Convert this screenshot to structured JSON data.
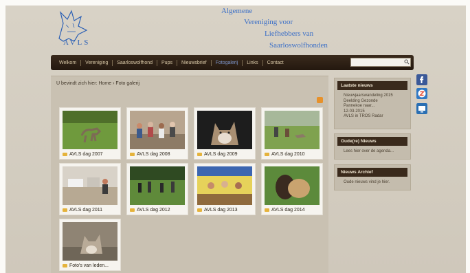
{
  "header": {
    "logo_text": "AVLS",
    "tagline": [
      "Algemene",
      "Vereniging voor",
      "Liefhebbers van",
      "Saarloswolfhonden"
    ]
  },
  "nav": {
    "items": [
      "Welkom",
      "Vereniging",
      "Saarloswolfhond",
      "Pups",
      "Nieuwsbrief",
      "Fotogalerij",
      "Links",
      "Contact"
    ],
    "active_index": 5,
    "search_placeholder": ""
  },
  "breadcrumb": {
    "prefix": "U bevindt zich hier:",
    "home": "Home",
    "separator": "›",
    "current": "Foto galerij"
  },
  "gallery": {
    "items": [
      {
        "label": "AVLS dag 2007",
        "thumb": "dog-on-grass"
      },
      {
        "label": "AVLS dag 2008",
        "thumb": "people-with-dogs"
      },
      {
        "label": "AVLS dag 2009",
        "thumb": "wolfdog-portrait"
      },
      {
        "label": "AVLS dag 2010",
        "thumb": "dogs-on-field"
      },
      {
        "label": "AVLS dag 2011",
        "thumb": "indoor-table"
      },
      {
        "label": "AVLS dag 2012",
        "thumb": "people-in-park"
      },
      {
        "label": "AVLS dag 2013",
        "thumb": "tent-gathering"
      },
      {
        "label": "AVLS dag 2014",
        "thumb": "person-hugging-dog"
      },
      {
        "label": "Foto's van leden...",
        "thumb": "wolfdog-on-rocks"
      }
    ]
  },
  "sidebar": {
    "latest": {
      "title": "Laatste nieuws",
      "lines": [
        "Nieuwjaarswandeling 2015",
        "Deelding Gezonde",
        "Pannekoe naar...",
        "12-03-2015",
        "AVLS in TROS Radar"
      ]
    },
    "agenda": {
      "title": "Oude(re) Nieuws",
      "lines": [
        "Lees hier over de agenda..."
      ]
    },
    "archive": {
      "title": "Nieuws Archief",
      "lines": [
        "Oude nieuws vind je hier."
      ]
    }
  },
  "social": [
    "facebook-icon",
    "z-circle-icon",
    "display-icon"
  ],
  "colors": {
    "nav_bg": "#2e2116",
    "accent_blue": "#3b6fc7",
    "page_bg": "#d4cdc0"
  }
}
